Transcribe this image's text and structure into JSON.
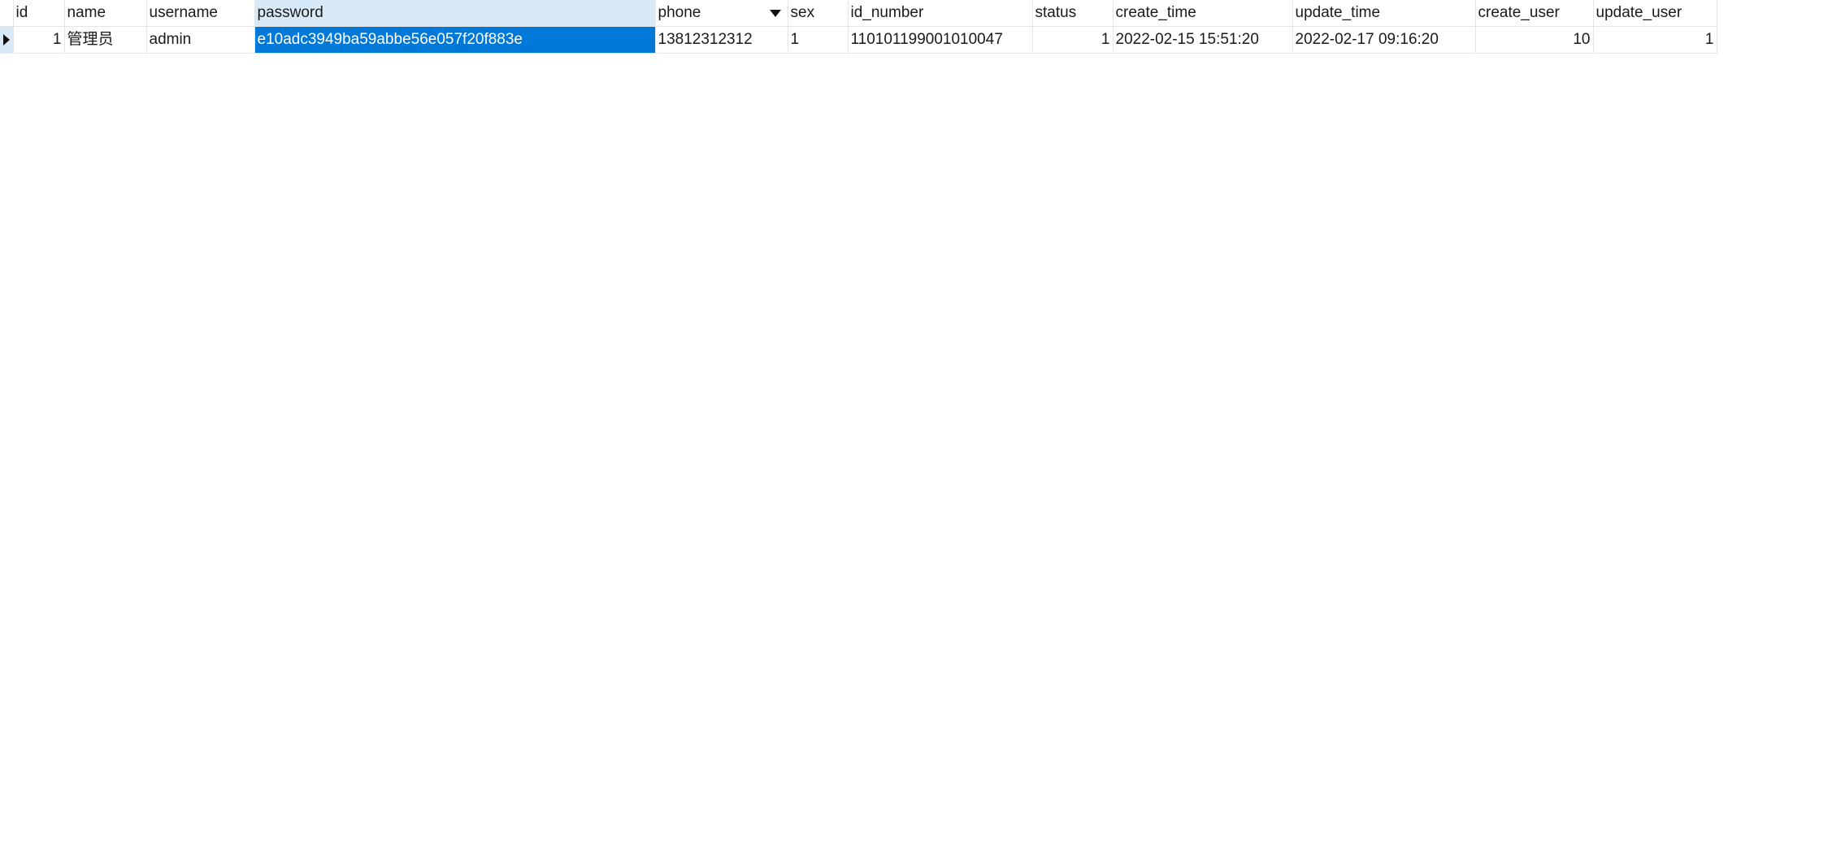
{
  "table": {
    "columns": [
      {
        "key": "id",
        "label": "id"
      },
      {
        "key": "name",
        "label": "name"
      },
      {
        "key": "username",
        "label": "username"
      },
      {
        "key": "password",
        "label": "password"
      },
      {
        "key": "phone",
        "label": "phone",
        "sorted": "descending"
      },
      {
        "key": "sex",
        "label": "sex"
      },
      {
        "key": "id_number",
        "label": "id_number"
      },
      {
        "key": "status",
        "label": "status"
      },
      {
        "key": "create_time",
        "label": "create_time"
      },
      {
        "key": "update_time",
        "label": "update_time"
      },
      {
        "key": "create_user",
        "label": "create_user"
      },
      {
        "key": "update_user",
        "label": "update_user"
      }
    ],
    "rows": [
      {
        "id": "1",
        "name": "管理员",
        "username": "admin",
        "password": "e10adc3949ba59abbe56e057f20f883e",
        "phone": "13812312312",
        "sex": "1",
        "id_number": "110101199001010047",
        "status": "1",
        "create_time": "2022-02-15 15:51:20",
        "update_time": "2022-02-17 09:16:20",
        "create_user": "10",
        "update_user": "1"
      }
    ],
    "selected_cell": {
      "row": 0,
      "column": "password"
    },
    "current_row_indicator": "triangle-right-icon",
    "sort_indicator": "sort-desc-icon"
  },
  "colors": {
    "selection": "#0078d7",
    "selected_column_header": "#d8e9f7",
    "grid_line": "#e6e6e6"
  }
}
